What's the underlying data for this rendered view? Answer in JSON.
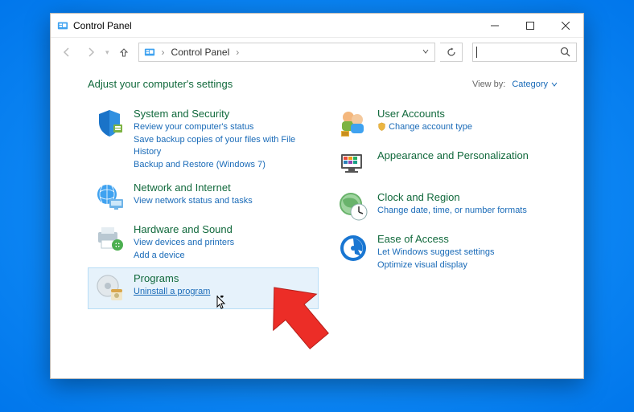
{
  "window": {
    "title": "Control Panel"
  },
  "address": {
    "crumb1": "Control Panel",
    "sep": "›"
  },
  "search": {
    "placeholder": "",
    "value": ""
  },
  "content": {
    "heading": "Adjust your computer's settings",
    "viewby_label": "View by:",
    "viewby_value": "Category"
  },
  "left": [
    {
      "title": "System and Security",
      "links": [
        "Review your computer's status",
        "Save backup copies of your files with File History",
        "Backup and Restore (Windows 7)"
      ]
    },
    {
      "title": "Network and Internet",
      "links": [
        "View network status and tasks"
      ]
    },
    {
      "title": "Hardware and Sound",
      "links": [
        "View devices and printers",
        "Add a device"
      ]
    },
    {
      "title": "Programs",
      "links": [
        "Uninstall a program"
      ]
    }
  ],
  "right": [
    {
      "title": "User Accounts",
      "links": [
        "Change account type"
      ]
    },
    {
      "title": "Appearance and Personalization",
      "links": []
    },
    {
      "title": "Clock and Region",
      "links": [
        "Change date, time, or number formats"
      ]
    },
    {
      "title": "Ease of Access",
      "links": [
        "Let Windows suggest settings",
        "Optimize visual display"
      ]
    }
  ]
}
